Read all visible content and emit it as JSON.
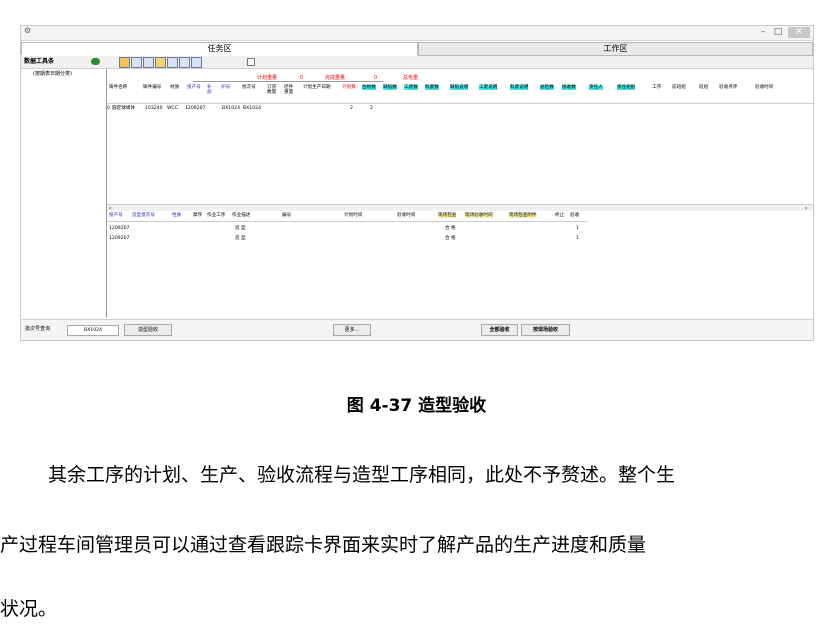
{
  "window": {
    "logo_glyph": "⚙",
    "minimize_glyph": "–",
    "maximize_glyph": "□",
    "close_glyph": "✕"
  },
  "tabs": {
    "task": "任务区",
    "work": "工作区"
  },
  "toolbar": {
    "title": "数据工具条"
  },
  "left_panel": {
    "header": "(按期表日期分类)"
  },
  "summary": {
    "plan_weight_label": "计划重量",
    "plan_weight_value": "0",
    "done_weight_label": "完成重量",
    "done_weight_value": "0",
    "gross_weight_label": "总毛重"
  },
  "grid1": {
    "headers": [
      "铸件名称",
      "铸件编号",
      "材质",
      "投产号",
      "补加",
      "炉号",
      "批次号",
      "订货数量",
      "坯件重量",
      "计划生产日期",
      "计划数",
      "合格数",
      "缺陷数",
      "工废数",
      "料废数",
      "缺陷说明",
      "工废说明",
      "料废说明",
      "总检数",
      "接收数",
      "责任人",
      "责任组别",
      "工序",
      "前班组",
      "班组",
      "验收点评",
      "验收时间"
    ],
    "rows": [
      [
        "0",
        "圆定球阀体",
        "103240",
        "WCC",
        "1209207",
        "",
        "BX1024",
        "BX1024",
        "",
        "",
        "",
        "2",
        "2",
        "",
        "",
        "",
        "",
        "",
        "",
        "",
        "",
        "",
        "",
        "",
        "",
        "",
        ""
      ]
    ]
  },
  "grid2": {
    "headers": [
      "投产号",
      "造型批次号",
      "性质",
      "摩序",
      "作业工序",
      "作业描述",
      "编号",
      "计划时间",
      "验收时间",
      "现场检查",
      "现场验收时间",
      "现场检查附件",
      "终止",
      "验收"
    ],
    "rows": [
      [
        "1209207",
        "",
        "",
        "",
        "造 型",
        "",
        "",
        "",
        "",
        "合 格",
        "",
        "",
        "",
        "1"
      ],
      [
        "1209207",
        "",
        "",
        "",
        "造 型",
        "",
        "",
        "",
        "",
        "合 格",
        "",
        "",
        "",
        "1"
      ]
    ]
  },
  "bottom": {
    "batch_query_label": "批次号查询",
    "batch_query_value": "BX1024",
    "check_button": "造型验收",
    "more_button": "更多...",
    "accept_all_button": "全部验收",
    "accept_site_button": "按现场验收"
  },
  "caption": "图 4-37  造型验收",
  "paragraph": {
    "line1": "其余工序的计划、生产、验收流程与造型工序相同，此处不予赘述。整个生",
    "line2": "产过程车间管理员可以通过查看跟踪卡界面来实时了解产品的生产进度和质量",
    "line3": "状况。"
  }
}
